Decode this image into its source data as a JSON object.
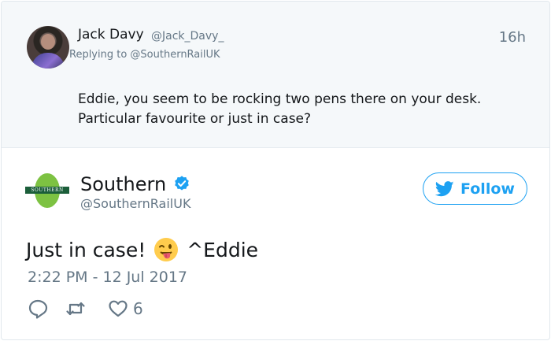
{
  "parent_tweet": {
    "author_name": "Jack Davy",
    "author_handle": "@Jack_Davy_",
    "time_ago": "16h",
    "replying_to": "Replying to @SouthernRailUK",
    "text_line1": "Eddie, you seem to be rocking two pens there on your desk.",
    "text_line2": "Particular favourite or just in case?"
  },
  "main_tweet": {
    "author_name": "Southern",
    "author_handle": "@SouthernRailUK",
    "logo_text": "SOUTHERN",
    "follow_label": "Follow",
    "text_before_emoji": "Just in case!",
    "emoji_name": "winking-face-with-tongue-emoji",
    "text_after_emoji": "^Eddie",
    "timestamp": "2:22 PM - 12 Jul 2017",
    "like_count": "6"
  },
  "colors": {
    "accent": "#1da1f2",
    "muted": "#657786",
    "text": "#14171a",
    "parent_bg": "#f5f8fa",
    "brand_green": "#7dc242",
    "brand_dark": "#1b5e3a"
  },
  "icons": [
    "verified-badge-icon",
    "twitter-bird-icon",
    "reply-icon",
    "retweet-icon",
    "heart-icon"
  ]
}
